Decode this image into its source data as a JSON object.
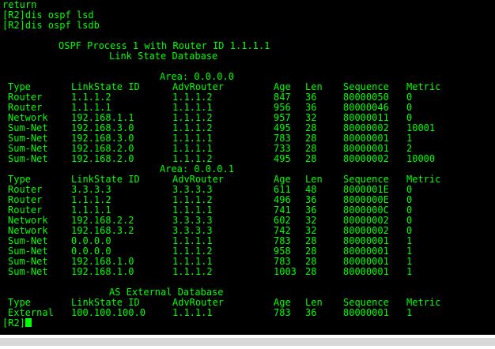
{
  "colors": {
    "background": "#000000",
    "text": "#00ff00"
  },
  "preamble": [
    "return",
    "[R2]dis ospf lsd",
    "[R2]dis ospf lsdb"
  ],
  "header": {
    "title": "OSPF Process 1 with Router ID 1.1.1.1",
    "subtitle": "Link State Database"
  },
  "columns": [
    "Type",
    "LinkState ID",
    "AdvRouter",
    "Age",
    "Len",
    "Sequence",
    "Metric"
  ],
  "areas": [
    {
      "label": "Area: 0.0.0.0",
      "rows": [
        [
          "Router",
          "1.1.1.2",
          "1.1.1.2",
          "847",
          "36",
          "80000050",
          "0"
        ],
        [
          "Router",
          "1.1.1.1",
          "1.1.1.1",
          "956",
          "36",
          "80000046",
          "0"
        ],
        [
          "Network",
          "192.168.1.1",
          "1.1.1.2",
          "957",
          "32",
          "80000011",
          "0"
        ],
        [
          "Sum-Net",
          "192.168.3.0",
          "1.1.1.2",
          "495",
          "28",
          "80000002",
          "10001"
        ],
        [
          "Sum-Net",
          "192.168.3.0",
          "1.1.1.1",
          "783",
          "28",
          "80000001",
          "1"
        ],
        [
          "Sum-Net",
          "192.168.2.0",
          "1.1.1.1",
          "733",
          "28",
          "80000001",
          "2"
        ],
        [
          "Sum-Net",
          "192.168.2.0",
          "1.1.1.2",
          "495",
          "28",
          "80000002",
          "10000"
        ]
      ]
    },
    {
      "label": "Area: 0.0.0.1",
      "rows": [
        [
          "Router",
          "3.3.3.3",
          "3.3.3.3",
          "611",
          "48",
          "8000001E",
          "0"
        ],
        [
          "Router",
          "1.1.1.2",
          "1.1.1.2",
          "496",
          "36",
          "8000000E",
          "0"
        ],
        [
          "Router",
          "1.1.1.1",
          "1.1.1.1",
          "741",
          "36",
          "8000000C",
          "0"
        ],
        [
          "Network",
          "192.168.2.2",
          "3.3.3.3",
          "602",
          "32",
          "80000002",
          "0"
        ],
        [
          "Network",
          "192.168.3.2",
          "3.3.3.3",
          "742",
          "32",
          "80000002",
          "0"
        ],
        [
          "Sum-Net",
          "0.0.0.0",
          "1.1.1.1",
          "783",
          "28",
          "80000001",
          "1"
        ],
        [
          "Sum-Net",
          "0.0.0.0",
          "1.1.1.2",
          "958",
          "28",
          "80000001",
          "1"
        ],
        [
          "Sum-Net",
          "192.168.1.0",
          "1.1.1.1",
          "783",
          "28",
          "80000001",
          "1"
        ],
        [
          "Sum-Net",
          "192.168.1.0",
          "1.1.1.2",
          "1003",
          "28",
          "80000001",
          "1"
        ]
      ]
    }
  ],
  "external": {
    "label": "AS External Database",
    "rows": [
      [
        "External",
        "100.100.100.0",
        "1.1.1.1",
        "783",
        "36",
        "80000001",
        "1"
      ]
    ]
  },
  "prompt": "[R2]"
}
